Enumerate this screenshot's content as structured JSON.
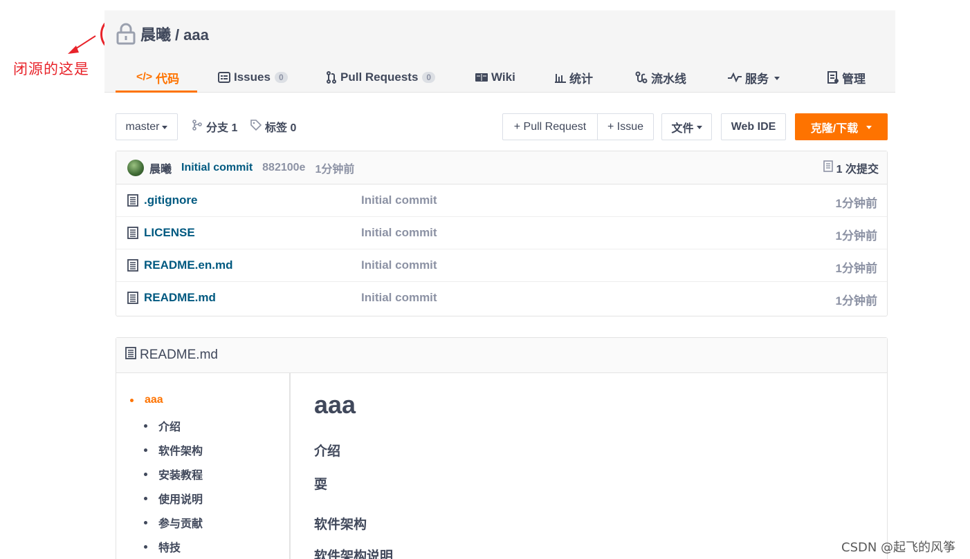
{
  "annotation": {
    "text": "闭源的这是",
    "color": "#e8232a"
  },
  "repo": {
    "owner": "晨曦",
    "separator": "/",
    "name": "aaa",
    "visibility_icon": "lock-icon"
  },
  "tabs": [
    {
      "icon": "code-icon",
      "label": "代码",
      "active": true
    },
    {
      "icon": "issues-icon",
      "label": "Issues",
      "count": "0"
    },
    {
      "icon": "pull-request-icon",
      "label": "Pull Requests",
      "count": "0"
    },
    {
      "icon": "wiki-icon",
      "label": "Wiki"
    },
    {
      "icon": "stats-icon",
      "label": "统计"
    },
    {
      "icon": "pipeline-icon",
      "label": "流水线"
    },
    {
      "icon": "services-icon",
      "label": "服务"
    },
    {
      "icon": "manage-icon",
      "label": "管理"
    }
  ],
  "toolbar": {
    "branch": "master",
    "branches_label": "分支 1",
    "tags_label": "标签 0",
    "pull_request_button": "+ Pull Request",
    "issue_button": "+ Issue",
    "files_button": "文件",
    "web_ide_button": "Web IDE",
    "clone_button": "克隆/下载"
  },
  "latest_commit": {
    "author": "晨曦",
    "message": "Initial commit",
    "sha": "882100e",
    "time": "1分钟前",
    "count_label": "1 次提交"
  },
  "files": [
    {
      "name": ".gitignore",
      "message": "Initial commit",
      "time": "1分钟前"
    },
    {
      "name": "LICENSE",
      "message": "Initial commit",
      "time": "1分钟前"
    },
    {
      "name": "README.en.md",
      "message": "Initial commit",
      "time": "1分钟前"
    },
    {
      "name": "README.md",
      "message": "Initial commit",
      "time": "1分钟前"
    }
  ],
  "readme": {
    "title": "README.md",
    "toc": [
      "aaa",
      "介绍",
      "软件架构",
      "安装教程",
      "使用说明",
      "参与贡献",
      "特技"
    ],
    "heading": "aaa",
    "section1": "介绍",
    "section1_body": "耍",
    "section2": "软件架构",
    "section2_body": "软件架构说明"
  },
  "watermark": "CSDN @起飞的风筝",
  "colors": {
    "accent": "#fe7300",
    "link": "#005980",
    "text": "#40485b",
    "muted": "#8c92a4"
  }
}
